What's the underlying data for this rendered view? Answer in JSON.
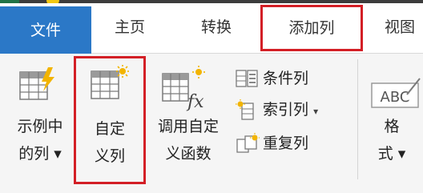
{
  "tabs": {
    "file": "文件",
    "home": "主页",
    "transform": "转换",
    "add_column": "添加列",
    "view": "视图"
  },
  "ribbon": {
    "column_from_examples": {
      "line1": "示例中",
      "line2": "的列 ▾"
    },
    "custom_column": {
      "line1": "自定",
      "line2": "义列"
    },
    "invoke_custom_function": {
      "line1": "调用自定",
      "line2": "义函数"
    },
    "conditional_column": "条件列",
    "index_column": "索引列",
    "index_caret": "▾",
    "duplicate_column": "重复列",
    "format": {
      "line1": "格",
      "line2": "式 ▾"
    }
  },
  "icons": {
    "fx_text": "fx",
    "abc_text": "ABC"
  },
  "colors": {
    "file_tab_bg": "#2b78c7",
    "highlight_border": "#d31f26",
    "ribbon_bg": "#f5f5f5"
  }
}
